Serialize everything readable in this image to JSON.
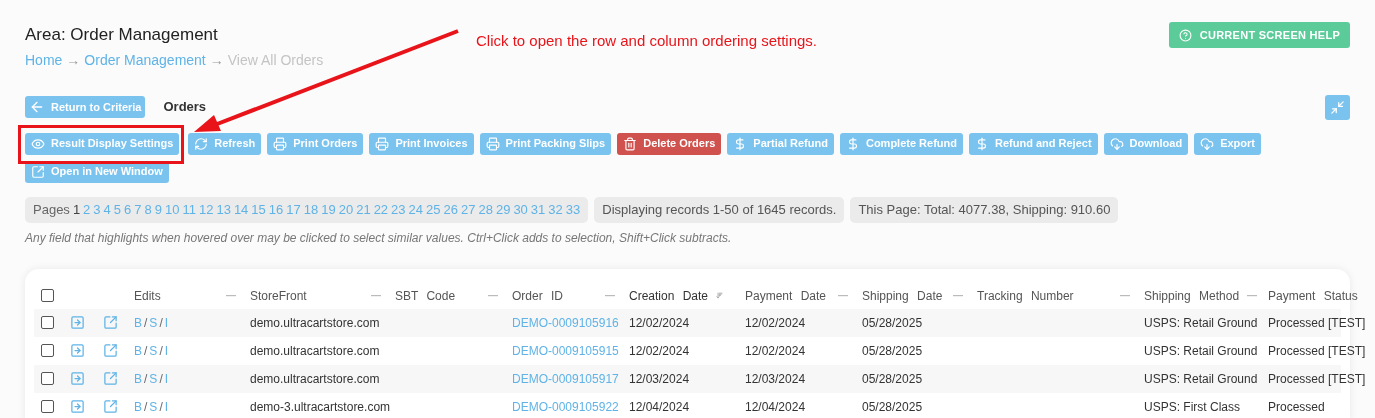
{
  "area_title": "Area: Order Management",
  "breadcrumb": [
    {
      "kind": "link",
      "text": "Home"
    },
    {
      "kind": "separator",
      "text": "→"
    },
    {
      "kind": "link",
      "text": "Order Management"
    },
    {
      "kind": "separator",
      "text": "→"
    },
    {
      "kind": "current",
      "text": "View All Orders"
    }
  ],
  "help_button": "CURRENT SCREEN HELP",
  "annotation": "Click to open the row and column ordering settings.",
  "return_button": "Return to Criteria",
  "section_title": "Orders",
  "toolbar": [
    {
      "label": "Result Display Settings",
      "kind": "default",
      "highlighted": true
    },
    {
      "label": "Refresh",
      "kind": "default",
      "highlighted": false
    },
    {
      "label": "Print Orders",
      "kind": "default",
      "highlighted": false
    },
    {
      "label": "Print Invoices",
      "kind": "default",
      "highlighted": false
    },
    {
      "label": "Print Packing Slips",
      "kind": "default",
      "highlighted": false
    },
    {
      "label": "Delete Orders",
      "kind": "danger",
      "highlighted": false
    },
    {
      "label": "Partial Refund",
      "kind": "default",
      "highlighted": false
    },
    {
      "label": "Complete Refund",
      "kind": "default",
      "highlighted": false
    },
    {
      "label": "Refund and Reject",
      "kind": "default",
      "highlighted": false
    },
    {
      "label": "Download",
      "kind": "default",
      "highlighted": false
    },
    {
      "label": "Export",
      "kind": "default",
      "highlighted": false
    },
    {
      "label": "Open in New Window",
      "kind": "default",
      "highlighted": false
    }
  ],
  "pagination": {
    "label": "Pages",
    "pages": [
      {
        "text": "1",
        "selected": true
      },
      {
        "text": "2",
        "selected": false
      },
      {
        "text": "3",
        "selected": false
      },
      {
        "text": "4",
        "selected": false
      },
      {
        "text": "5",
        "selected": false
      },
      {
        "text": "6",
        "selected": false
      },
      {
        "text": "7",
        "selected": false
      },
      {
        "text": "8",
        "selected": false
      },
      {
        "text": "9",
        "selected": false
      },
      {
        "text": "10",
        "selected": false
      },
      {
        "text": "11",
        "selected": false
      },
      {
        "text": "12",
        "selected": false
      },
      {
        "text": "13",
        "selected": false
      },
      {
        "text": "14",
        "selected": false
      },
      {
        "text": "15",
        "selected": false
      },
      {
        "text": "16",
        "selected": false
      },
      {
        "text": "17",
        "selected": false
      },
      {
        "text": "18",
        "selected": false
      },
      {
        "text": "19",
        "selected": false
      },
      {
        "text": "20",
        "selected": false
      },
      {
        "text": "21",
        "selected": false
      },
      {
        "text": "22",
        "selected": false
      },
      {
        "text": "23",
        "selected": false
      },
      {
        "text": "24",
        "selected": false
      },
      {
        "text": "25",
        "selected": false
      },
      {
        "text": "26",
        "selected": false
      },
      {
        "text": "27",
        "selected": false
      },
      {
        "text": "28",
        "selected": false
      },
      {
        "text": "29",
        "selected": false
      },
      {
        "text": "30",
        "selected": false
      },
      {
        "text": "31",
        "selected": false
      },
      {
        "text": "32",
        "selected": false
      },
      {
        "text": "33",
        "selected": false
      }
    ]
  },
  "records_info": "Displaying records 1-50 of 1645 records.",
  "totals_info": "This Page: Total: 4077.38, Shipping: 910.60",
  "hint": "Any field that highlights when hovered over may be clicked to select similar values. Ctrl+Click adds to selection, Shift+Click subtracts.",
  "table": {
    "select_all_checked": false,
    "columns": [
      {
        "label": "Edits",
        "sorted": false
      },
      {
        "label": "StoreFront",
        "sorted": false
      },
      {
        "label": "SBT Code",
        "sorted": false
      },
      {
        "label": "Order ID",
        "sorted": false
      },
      {
        "label": "Creation Date",
        "sorted": true
      },
      {
        "label": "Payment Date",
        "sorted": false
      },
      {
        "label": "Shipping Date",
        "sorted": false
      },
      {
        "label": "Tracking Number",
        "sorted": false
      },
      {
        "label": "Shipping Method",
        "sorted": false
      },
      {
        "label": "Payment Status",
        "sorted": false
      }
    ],
    "rows": [
      {
        "checked": false,
        "edits": [
          {
            "kind": "link",
            "text": "B"
          },
          {
            "kind": "separator",
            "text": "/"
          },
          {
            "kind": "link",
            "text": "S"
          },
          {
            "kind": "separator",
            "text": "/"
          },
          {
            "kind": "link",
            "text": "I"
          }
        ],
        "storefront": "demo.ultracartstore.com",
        "order_id": "DEMO-0009105916",
        "creation_date": "12/02/2024",
        "payment_date": "12/02/2024",
        "shipping_date": "05/28/2025",
        "shipping_method": "USPS: Retail Ground",
        "payment_status": "Processed [TEST]"
      },
      {
        "checked": false,
        "edits": [
          {
            "kind": "link",
            "text": "B"
          },
          {
            "kind": "separator",
            "text": "/"
          },
          {
            "kind": "link",
            "text": "S"
          },
          {
            "kind": "separator",
            "text": "/"
          },
          {
            "kind": "link",
            "text": "I"
          }
        ],
        "storefront": "demo.ultracartstore.com",
        "order_id": "DEMO-0009105915",
        "creation_date": "12/02/2024",
        "payment_date": "12/02/2024",
        "shipping_date": "05/28/2025",
        "shipping_method": "USPS: Retail Ground",
        "payment_status": "Processed [TEST]"
      },
      {
        "checked": false,
        "edits": [
          {
            "kind": "link",
            "text": "B"
          },
          {
            "kind": "separator",
            "text": "/"
          },
          {
            "kind": "link",
            "text": "S"
          },
          {
            "kind": "separator",
            "text": "/"
          },
          {
            "kind": "link",
            "text": "I"
          }
        ],
        "storefront": "demo.ultracartstore.com",
        "order_id": "DEMO-0009105917",
        "creation_date": "12/03/2024",
        "payment_date": "12/03/2024",
        "shipping_date": "05/28/2025",
        "shipping_method": "USPS: Retail Ground",
        "payment_status": "Processed [TEST]"
      },
      {
        "checked": false,
        "edits": [
          {
            "kind": "link",
            "text": "B"
          },
          {
            "kind": "separator",
            "text": "/"
          },
          {
            "kind": "link",
            "text": "S"
          },
          {
            "kind": "separator",
            "text": "/"
          },
          {
            "kind": "link",
            "text": "I"
          }
        ],
        "storefront": "demo-3.ultracartstore.com",
        "order_id": "DEMO-0009105922",
        "creation_date": "12/04/2024",
        "payment_date": "12/04/2024",
        "shipping_date": "05/28/2025",
        "shipping_method": "USPS: First Class",
        "payment_status": "Processed"
      }
    ]
  }
}
